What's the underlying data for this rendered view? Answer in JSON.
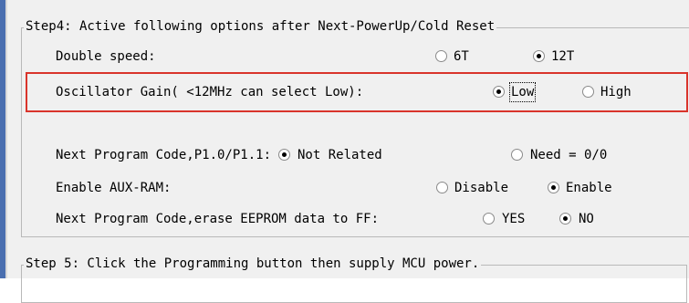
{
  "step4": {
    "title": "Step4: Active following options after Next-PowerUp/Cold Reset",
    "double_speed": {
      "label": "Double speed:",
      "opt1": "6T",
      "opt2": "12T",
      "selected": "12T"
    },
    "osc_gain": {
      "label": "Oscillator Gain( <12MHz can select Low):",
      "opt1": "Low",
      "opt2": "High",
      "selected": "Low"
    },
    "next_program": {
      "label": "Next Program Code,P1.0/P1.1:",
      "opt1": "Not Related",
      "opt2": "Need = 0/0",
      "selected": "Not Related"
    },
    "aux_ram": {
      "label": "Enable AUX-RAM:",
      "opt1": "Disable",
      "opt2": "Enable",
      "selected": "Enable"
    },
    "erase_eeprom": {
      "label": "Next Program Code,erase EEPROM data to FF:",
      "opt1": "YES",
      "opt2": "NO",
      "selected": "NO"
    }
  },
  "step5": {
    "title": "Step 5: Click the Programming button then supply MCU power."
  },
  "colors": {
    "highlight": "#d9342b",
    "panel": "#f0f0f0",
    "sidebar": "#4a6fb0"
  }
}
